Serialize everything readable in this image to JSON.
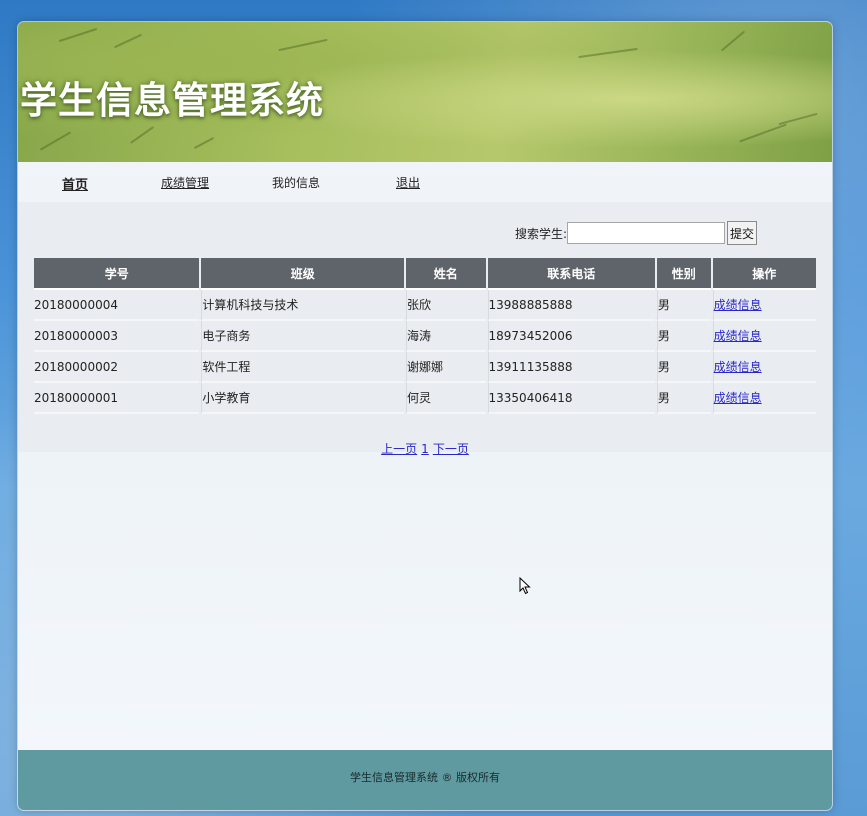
{
  "banner": {
    "title": "学生信息管理系统"
  },
  "nav": {
    "home": "首页",
    "scores": "成绩管理",
    "my_info": "我的信息",
    "logout": "退出"
  },
  "search": {
    "label": "搜索学生:",
    "value": "",
    "button": "提交"
  },
  "table": {
    "headers": [
      "学号",
      "班级",
      "姓名",
      "联系电话",
      "性别",
      "操作"
    ],
    "rows": [
      {
        "id": "20180000004",
        "class": "计算机科技与技术",
        "name": "张欣",
        "phone": "13988885888",
        "gender": "男",
        "action": "成绩信息"
      },
      {
        "id": "20180000003",
        "class": "电子商务",
        "name": "海涛",
        "phone": "18973452006",
        "gender": "男",
        "action": "成绩信息"
      },
      {
        "id": "20180000002",
        "class": "软件工程",
        "name": "谢娜娜",
        "phone": "13911135888",
        "gender": "男",
        "action": "成绩信息"
      },
      {
        "id": "20180000001",
        "class": "小学教育",
        "name": "何灵",
        "phone": "13350406418",
        "gender": "男",
        "action": "成绩信息"
      }
    ]
  },
  "pager": {
    "prev": "上一页",
    "page": "1",
    "next": "下一页"
  },
  "footer": {
    "text": "学生信息管理系统 ® 版权所有"
  },
  "colors": {
    "header_bg": "#5f646a",
    "link": "#2a27c9",
    "footer_bg": "#5e9aa0"
  }
}
